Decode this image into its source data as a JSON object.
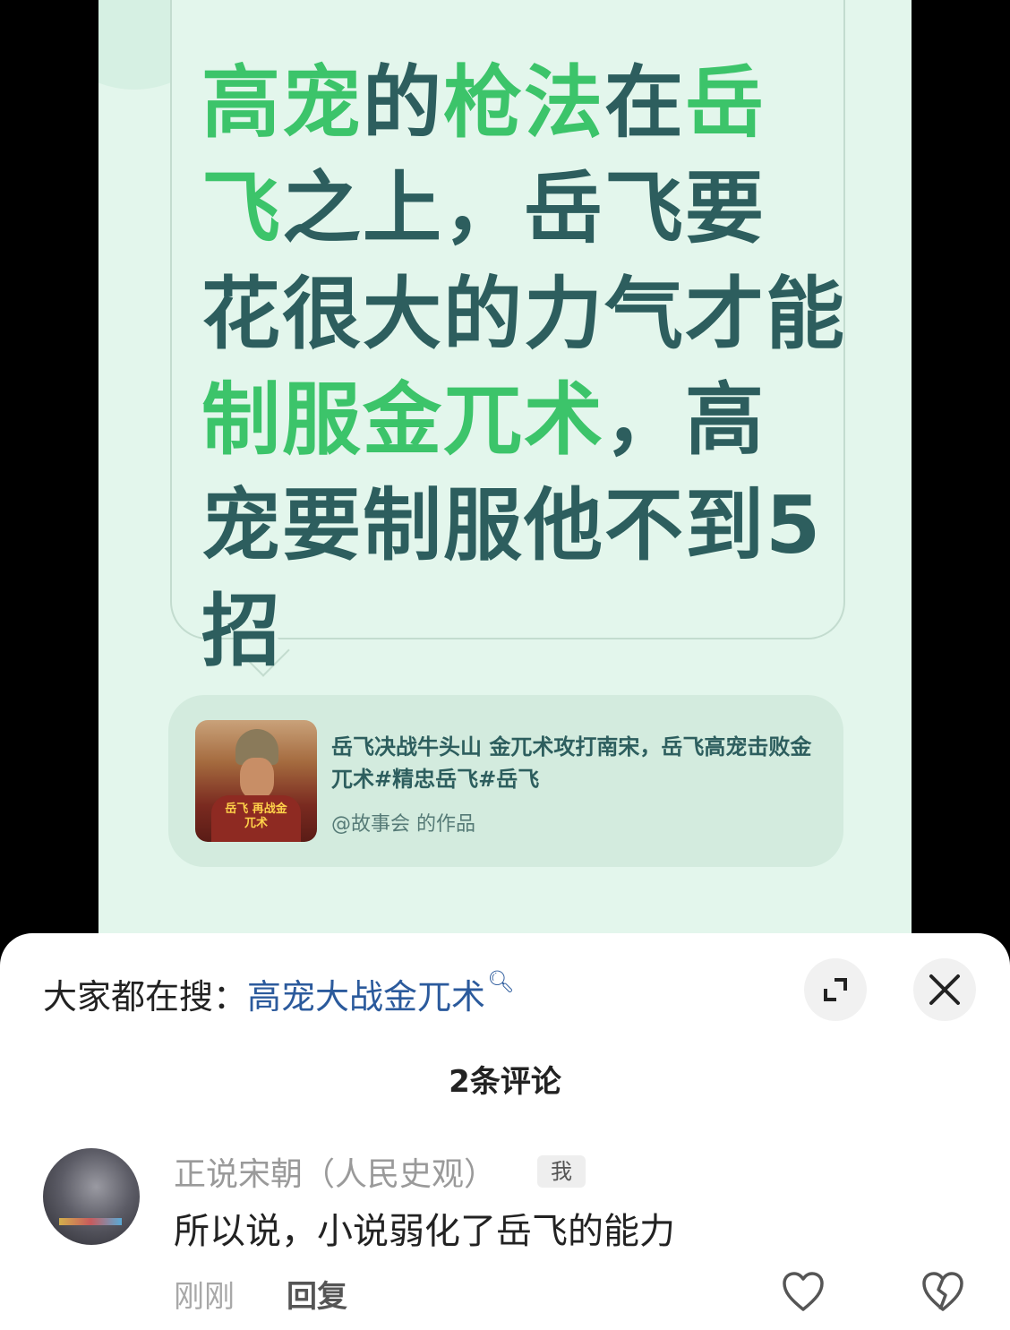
{
  "card": {
    "headline_parts": [
      {
        "text": "高宠",
        "highlight": true
      },
      {
        "text": "的",
        "highlight": false
      },
      {
        "text": "枪法",
        "highlight": true
      },
      {
        "text": "在",
        "highlight": false
      },
      {
        "text": "岳飞",
        "highlight": true
      },
      {
        "text": "之上，岳飞要花很大的力气才能",
        "highlight": false
      },
      {
        "text": "制服金兀术",
        "highlight": true
      },
      {
        "text": "，高宠要制服他不到5招",
        "highlight": false
      }
    ],
    "source": {
      "title": "岳飞决战牛头山 金兀术攻打南宋，岳飞高宠击败金兀术#精忠岳飞#岳飞",
      "author": "@故事会 的作品",
      "thumb_caption": "岳飞 再战金兀术"
    },
    "colors": {
      "highlight": "#3cc46a",
      "text": "#2d5e5e",
      "background": "#e3f6ec"
    }
  },
  "search": {
    "label": "大家都在搜：",
    "term": "高宠大战金兀术",
    "icon": "search-icon"
  },
  "comments": {
    "count_label": "2条评论",
    "items": [
      {
        "user": "正说宋朝（人民史观）",
        "badge": "我",
        "text": "所以说，小说弱化了岳飞的能力",
        "time": "刚刚",
        "reply_label": "回复"
      }
    ]
  },
  "icons": {
    "expand": "expand-icon",
    "close": "close-icon",
    "like": "heart-icon",
    "dislike": "broken-heart-icon"
  }
}
